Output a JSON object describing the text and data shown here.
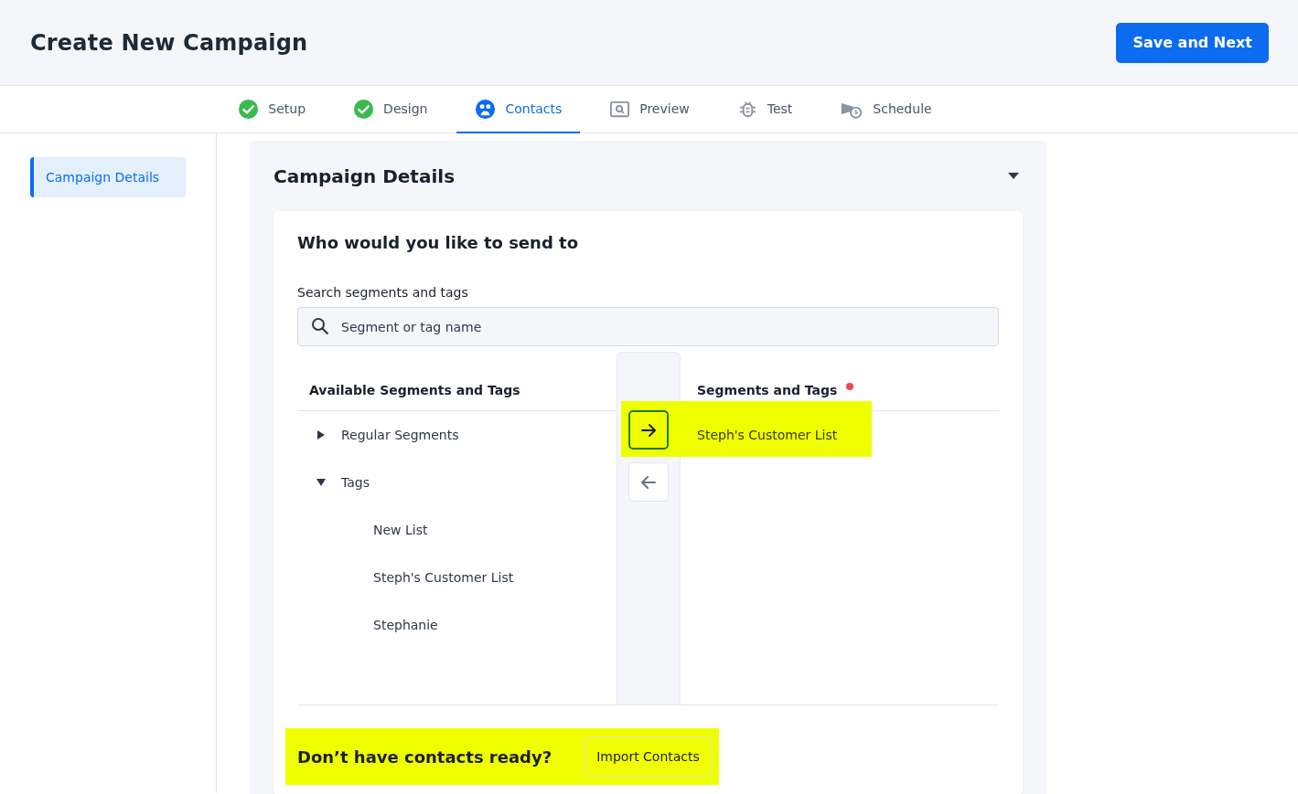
{
  "header": {
    "title": "Create New Campaign",
    "primary_button": "Save and Next"
  },
  "tabs": [
    {
      "label": "Setup",
      "completed": true,
      "selected": false
    },
    {
      "label": "Design",
      "completed": true,
      "selected": false
    },
    {
      "label": "Contacts",
      "kind": "contacts",
      "completed": false,
      "selected": true
    },
    {
      "label": "Preview",
      "kind": "preview",
      "completed": false,
      "selected": false
    },
    {
      "label": "Test",
      "kind": "test",
      "completed": false,
      "selected": false
    },
    {
      "label": "Schedule",
      "kind": "schedule",
      "completed": false,
      "selected": false
    }
  ],
  "sidebar": {
    "items": [
      {
        "label": "Campaign Details",
        "selected": true
      }
    ]
  },
  "section": {
    "title": "Campaign Details",
    "expanded": true,
    "card": {
      "heading": "Who would you like to send to",
      "search_label": "Search segments and tags",
      "search_placeholder": "Segment or tag name",
      "available": {
        "heading": "Available Segments and Tags",
        "tree": [
          {
            "label": "Regular Segments",
            "expanded": false
          },
          {
            "label": "Tags",
            "expanded": true,
            "children": [
              {
                "label": "New List"
              },
              {
                "label": "Steph's Customer List"
              },
              {
                "label": "Stephanie"
              }
            ]
          }
        ]
      },
      "move_right": {
        "highlighted": true
      },
      "chosen": {
        "heading": "Segments and Tags",
        "required": true,
        "items": [
          {
            "label": "Steph's Customer List",
            "highlighted": true
          }
        ]
      },
      "import": {
        "prompt": "Don’t have contacts ready?",
        "button": "Import Contacts",
        "highlighted": true
      }
    }
  }
}
